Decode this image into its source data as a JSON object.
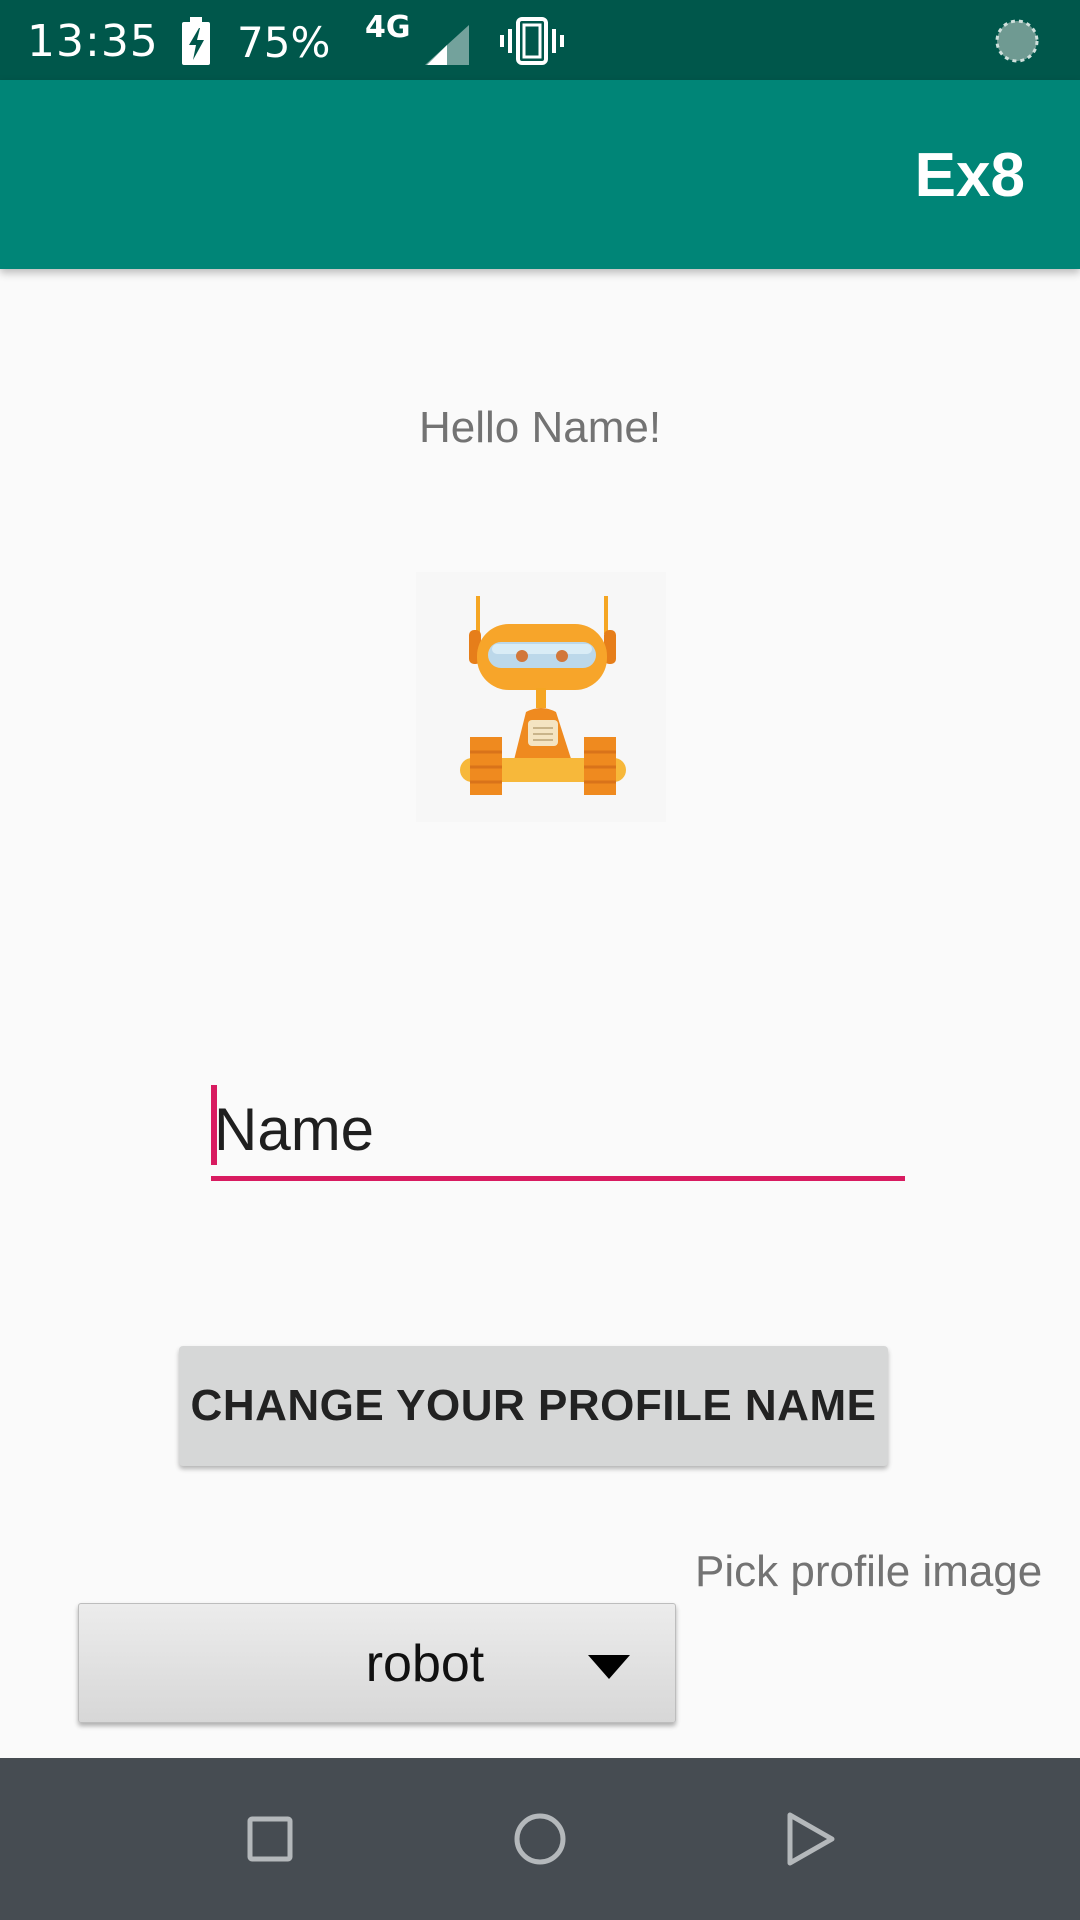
{
  "status_bar": {
    "time": "13:35",
    "battery": "75%",
    "network": "4G",
    "icons": [
      "battery-charging-icon",
      "signal-icon",
      "vibrate-icon",
      "loading-icon"
    ]
  },
  "app_bar": {
    "title": "Ex8"
  },
  "main": {
    "greeting": "Hello Name!",
    "profile_image": "robot",
    "name_input": {
      "value": "Name"
    },
    "change_button": "CHANGE YOUR PROFILE NAME",
    "pick_label": "Pick profile image",
    "spinner": {
      "selected": "robot"
    }
  },
  "nav_bar": {
    "icons": [
      "recents-icon",
      "home-icon",
      "back-icon"
    ]
  },
  "colors": {
    "status_bar": "#00574b",
    "app_bar": "#008577",
    "accent": "#d81b60",
    "nav_bar": "#464c52"
  }
}
